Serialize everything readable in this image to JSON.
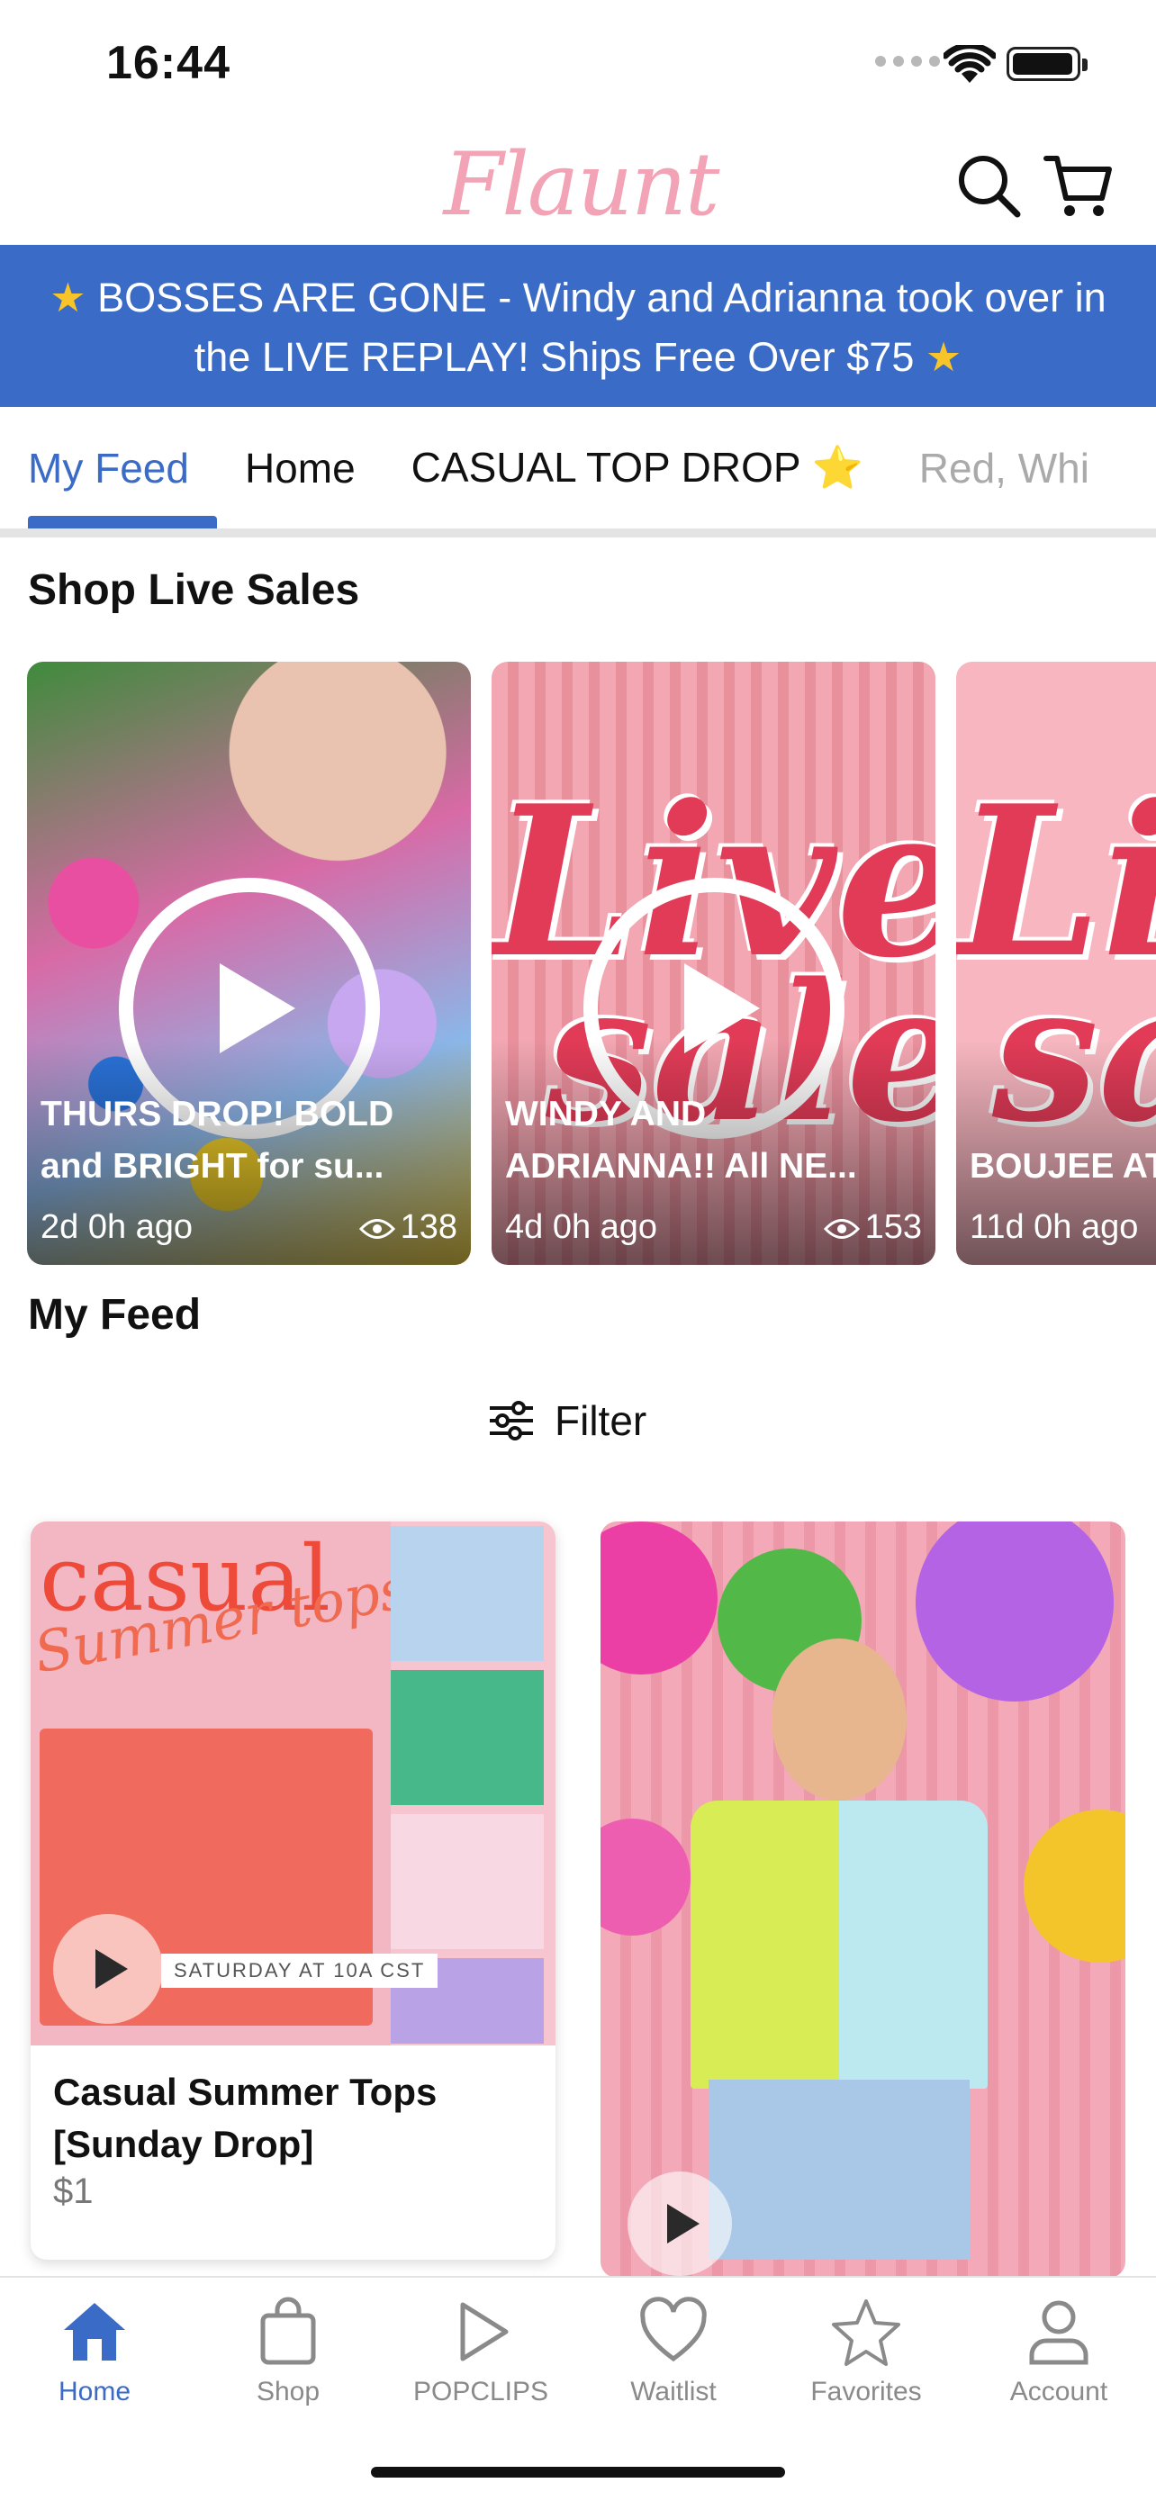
{
  "status_bar": {
    "time": "16:44"
  },
  "header": {
    "logo_text": "Flaunt",
    "search_icon": "search-icon",
    "cart_icon": "cart-icon"
  },
  "banner": {
    "line1": "BOSSES ARE GONE - Windy and Adrianna took over in",
    "line2": "the LIVE REPLAY! Ships Free Over $75",
    "color": "#3a6bc6"
  },
  "tabs": [
    {
      "label": "My Feed"
    },
    {
      "label": "Home"
    },
    {
      "label": "CASUAL TOP DROP ⭐"
    },
    {
      "label": "Red, Whi"
    }
  ],
  "live_sales": {
    "title": "Shop Live Sales",
    "cards": [
      {
        "title": "THURS DROP! BOLD and BRIGHT for su...",
        "age": "2d 0h ago",
        "views": "138"
      },
      {
        "title": "WINDY AND ADRIANNA!! All NE...",
        "age": "4d 0h ago",
        "views": "153",
        "overlay_top": "Live",
        "overlay_bottom": "sale"
      },
      {
        "title": "BOUJEE ATHLEISURE",
        "age": "11d 0h ago",
        "views": "",
        "overlay_top": "Li",
        "overlay_bottom": "sa"
      }
    ]
  },
  "feed": {
    "title": "My Feed",
    "filter_label": "Filter",
    "products": [
      {
        "title": "Casual Summer Tops [Sunday Drop]",
        "price": "$1",
        "image_headline": "casual",
        "image_script": "Summer tops",
        "image_caption": "SATURDAY AT 10A CST"
      },
      {
        "title": "",
        "price": ""
      }
    ]
  },
  "bottom_nav": [
    {
      "label": "Home",
      "icon": "home-icon",
      "active": true
    },
    {
      "label": "Shop",
      "icon": "bag-icon"
    },
    {
      "label": "POPCLIPS",
      "icon": "play-icon"
    },
    {
      "label": "Waitlist",
      "icon": "heart-icon"
    },
    {
      "label": "Favorites",
      "icon": "star-icon"
    },
    {
      "label": "Account",
      "icon": "person-icon"
    }
  ]
}
